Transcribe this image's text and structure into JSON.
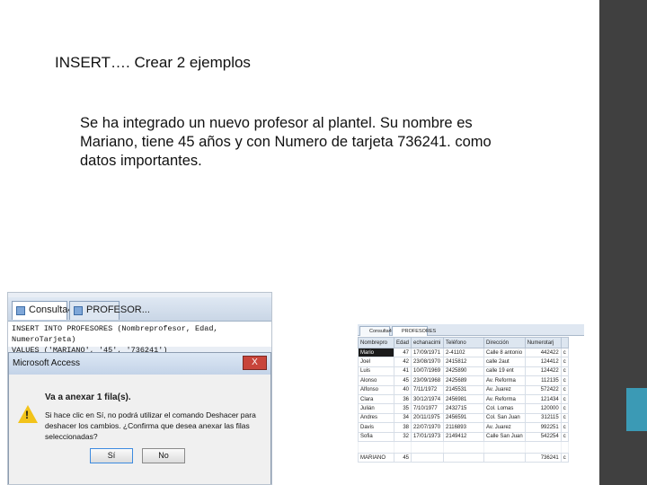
{
  "slide": {
    "title": "INSERT…. Crear 2 ejemplos",
    "body": "Se ha integrado un nuevo profesor al plantel. Su nombre es Mariano, tiene 45 años y con Numero de tarjeta 736241. como datos importantes."
  },
  "colors": {
    "side_bar": "#404040",
    "accent": "#3b9ab5"
  },
  "query_window": {
    "tabs": [
      "Consulta4",
      "PROFESOR..."
    ],
    "sql_line1": "INSERT INTO PROFESORES (Nombreprofesor, Edad, NumeroTarjeta)",
    "sql_line2": "VALUES ('MARIANO', '45', '736241')"
  },
  "dialog": {
    "title": "Microsoft Access",
    "close_label": "X",
    "heading": "Va a anexar 1 fila(s).",
    "message": "Si hace clic en Sí, no podrá utilizar el comando Deshacer para deshacer los cambios. ¿Confirma que desea anexar las filas seleccionadas?",
    "yes_label": "Sí",
    "no_label": "No",
    "icon": "warning-icon"
  },
  "datasheet": {
    "tabs": [
      "Consulta4",
      "PROFESORES"
    ],
    "columns": [
      "Nombrepro",
      "Edad",
      "echanacimi",
      "Teléfono",
      "Dirección",
      "Numerotarj",
      ""
    ],
    "rows": [
      [
        "Mario",
        "47",
        "17/09/1971",
        "2-41102",
        "Calle 8 antonio",
        "442422",
        "c"
      ],
      [
        "Joel",
        "42",
        "23/08/1970",
        "2415812",
        "calle 2aut",
        "124412",
        "c"
      ],
      [
        "Luis",
        "41",
        "10/07/1969",
        "2425890",
        "calle 19 ent",
        "124422",
        "c"
      ],
      [
        "Alonso",
        "45",
        "23/09/1968",
        "2425689",
        "Av. Reforma",
        "112135",
        "c"
      ],
      [
        "Alfonso",
        "40",
        "7/11/1972",
        "2145531",
        "Av. Juarez",
        "572422",
        "c"
      ],
      [
        "Clara",
        "36",
        "30/12/1974",
        "2456981",
        "Av. Reforma",
        "121434",
        "c"
      ],
      [
        "Julián",
        "35",
        "7/10/1977",
        "2432715",
        "Col. Lomas",
        "120000",
        "c"
      ],
      [
        "Andres",
        "34",
        "20/11/1975",
        "2456591",
        "Col. San Juan",
        "312115",
        "c"
      ],
      [
        "Davis",
        "38",
        "22/07/1970",
        "2116893",
        "Av. Juarez",
        "992251",
        "c"
      ],
      [
        "Sofia",
        "32",
        "17/01/1973",
        "2149412",
        "Calle San Juan",
        "542254",
        "c"
      ]
    ],
    "new_row": [
      "MARIANO",
      "45",
      "",
      "",
      "",
      "736241",
      "c"
    ]
  }
}
